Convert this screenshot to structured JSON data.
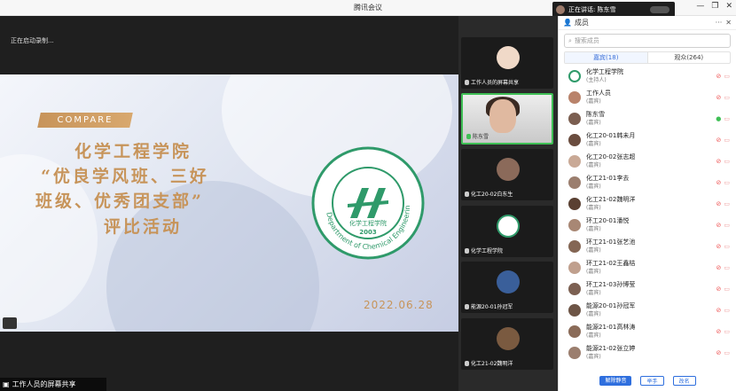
{
  "window": {
    "title": "腾讯会议"
  },
  "speaking": {
    "label": "正在讲话: 陈东雪"
  },
  "main": {
    "recording_text": "正在启动录制...",
    "share_label": "工作人员的屏幕共享"
  },
  "slide": {
    "compare": "COMPARE",
    "line1": "化学工程学院",
    "line2": "“优良学风班、三好",
    "line3": "班级、优秀团支部”",
    "line4": "评比活动",
    "date": "2022.06.28",
    "logo_year": "2003",
    "logo_text_cn": "化学工程学院",
    "logo_text_en": "Department of Chemical Engineering"
  },
  "video_tiles": [
    {
      "label": "工作人员的屏幕共享"
    },
    {
      "label": "陈东雪"
    },
    {
      "label": "化工20-02白东生"
    },
    {
      "label": "化学工程学院"
    },
    {
      "label": "能源20-01孙冠军"
    },
    {
      "label": "化工21-02魏明洋"
    }
  ],
  "panel": {
    "title": "成员",
    "search_placeholder": "搜索成员",
    "tab_guests": "嘉宾(18)",
    "tab_viewers": "观众(264)",
    "btn_mute_all": "解除静音",
    "btn_hand": "举手",
    "btn_rename": "改名"
  },
  "members": [
    {
      "name": "化学工程学院",
      "role": "(主持人)"
    },
    {
      "name": "工作人员",
      "role": "(嘉宾)"
    },
    {
      "name": "陈东雪",
      "role": "(嘉宾)"
    },
    {
      "name": "化工20-01韩未月",
      "role": "(嘉宾)"
    },
    {
      "name": "化工20-02张志超",
      "role": "(嘉宾)"
    },
    {
      "name": "化工21-01李去",
      "role": "(嘉宾)"
    },
    {
      "name": "化工21-02魏明洋",
      "role": "(嘉宾)"
    },
    {
      "name": "环工20-01潘悦",
      "role": "(嘉宾)"
    },
    {
      "name": "环工21-01张艺池",
      "role": "(嘉宾)"
    },
    {
      "name": "环工21-02王鑫桔",
      "role": "(嘉宾)"
    },
    {
      "name": "环工21-03孙博莹",
      "role": "(嘉宾)"
    },
    {
      "name": "能源20-01孙冠军",
      "role": "(嘉宾)"
    },
    {
      "name": "能源21-01高林涛",
      "role": "(嘉宾)"
    },
    {
      "name": "能源21-02张立婷",
      "role": "(嘉宾)"
    }
  ]
}
